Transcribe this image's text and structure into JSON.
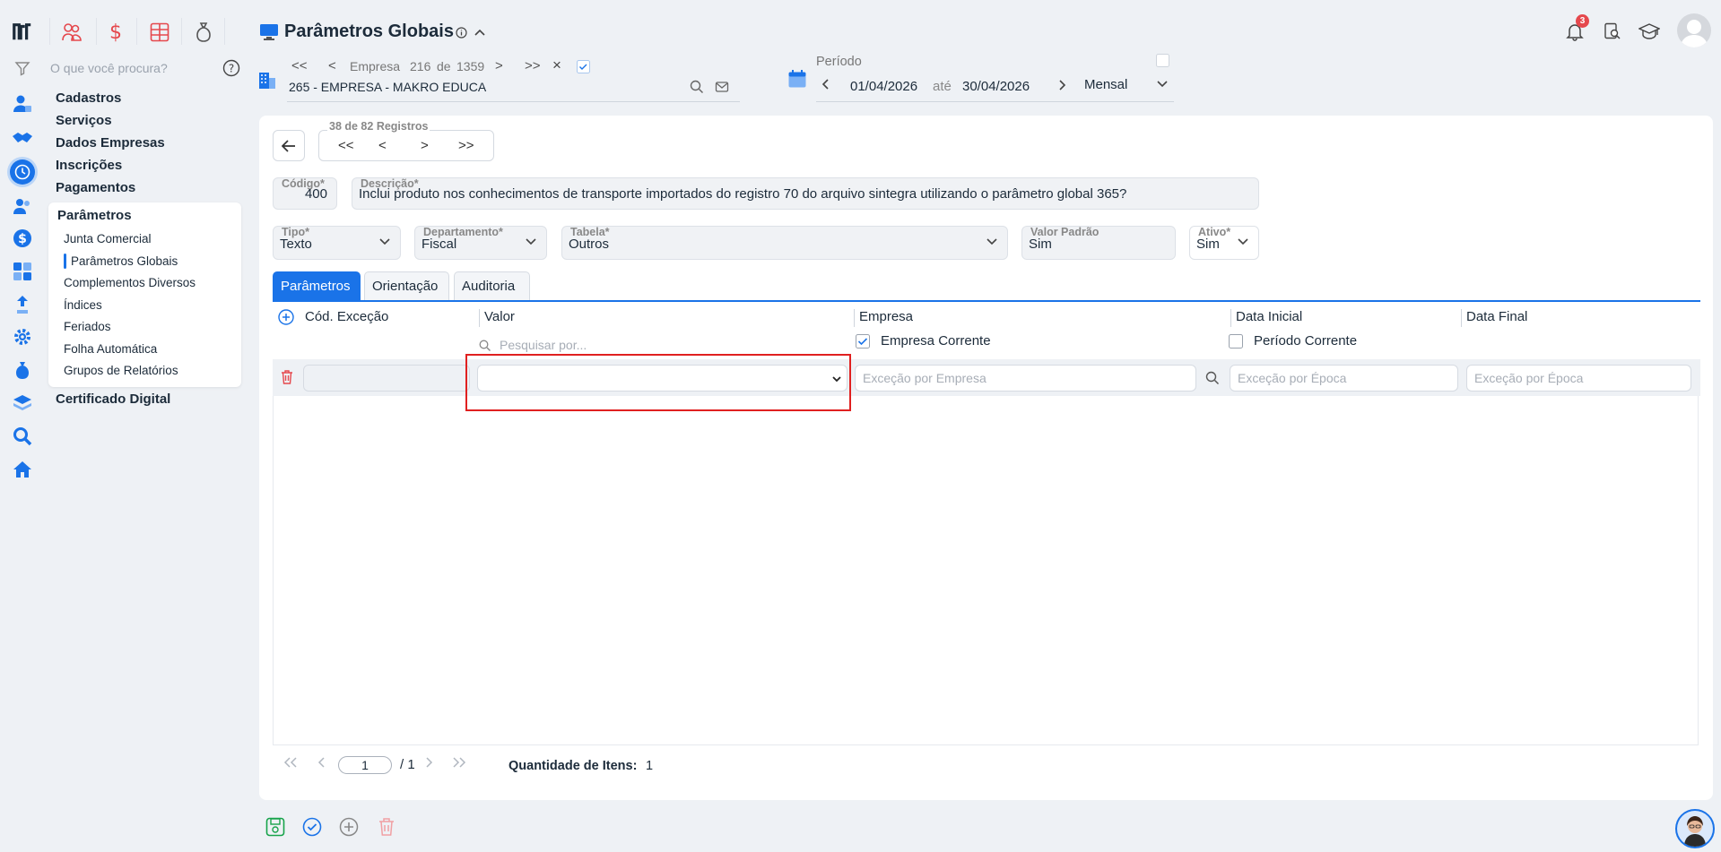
{
  "app": {
    "search_placeholder": "O que você procura?",
    "notification_count": "3"
  },
  "menu": {
    "items": [
      "Cadastros",
      "Serviços",
      "Dados Empresas",
      "Inscrições",
      "Pagamentos"
    ],
    "submenu_title": "Parâmetros",
    "subitems": [
      "Junta Comercial",
      "Parâmetros Globais",
      "Complementos Diversos",
      "Índices",
      "Feriados",
      "Folha Automática",
      "Grupos de Relatórios"
    ],
    "active_subitem": "Parâmetros Globais",
    "after": "Certificado Digital"
  },
  "header": {
    "title": "Parâmetros Globais",
    "company_nav": {
      "first": "<<",
      "prev": "<",
      "label": "Empresa",
      "current": "216",
      "of": "de",
      "total": "1359",
      "next": ">",
      "last": ">>",
      "clear": "×"
    },
    "company_name": "265 - EMPRESA - MAKRO EDUCA",
    "period": {
      "label": "Período",
      "start": "01/04/2026",
      "sep": "até",
      "end": "30/04/2026",
      "mode": "Mensal"
    }
  },
  "record_nav": {
    "label": "38 de 82 Registros",
    "first": "<<",
    "prev": "<",
    "next": ">",
    "last": ">>"
  },
  "form": {
    "codigo": {
      "label": "Código*",
      "value": "400"
    },
    "descricao": {
      "label": "Descrição*",
      "value": "Inclui produto nos conhecimentos de transporte importados do registro 70 do arquivo sintegra utilizando o parâmetro global 365?"
    },
    "tipo": {
      "label": "Tipo*",
      "value": "Texto"
    },
    "departamento": {
      "label": "Departamento*",
      "value": "Fiscal"
    },
    "tabela": {
      "label": "Tabela*",
      "value": "Outros"
    },
    "valor_padrao": {
      "label": "Valor Padrão",
      "value": "Sim"
    },
    "ativo": {
      "label": "Ativo*",
      "value": "Sim"
    }
  },
  "tabs": [
    "Parâmetros",
    "Orientação",
    "Auditoria"
  ],
  "grid": {
    "columns": [
      "Cód. Exceção",
      "Valor",
      "Empresa",
      "Data Inicial",
      "Data Final"
    ],
    "valor_search_placeholder": "Pesquisar por...",
    "empresa_checkbox_label": "Empresa Corrente",
    "empresa_checked": true,
    "data_checkbox_label": "Período Corrente",
    "data_checked": false,
    "row": {
      "empresa_placeholder": "Exceção por Empresa",
      "data_inicial_placeholder": "Exceção por Época",
      "data_final_placeholder": "Exceção por Época"
    }
  },
  "pager": {
    "page": "1",
    "total": "/ 1",
    "qty_label": "Quantidade de Itens:",
    "qty_value": "1"
  },
  "colors": {
    "accent": "#1a73e8",
    "danger": "#e5484d",
    "highlight_box": "#e02020"
  }
}
